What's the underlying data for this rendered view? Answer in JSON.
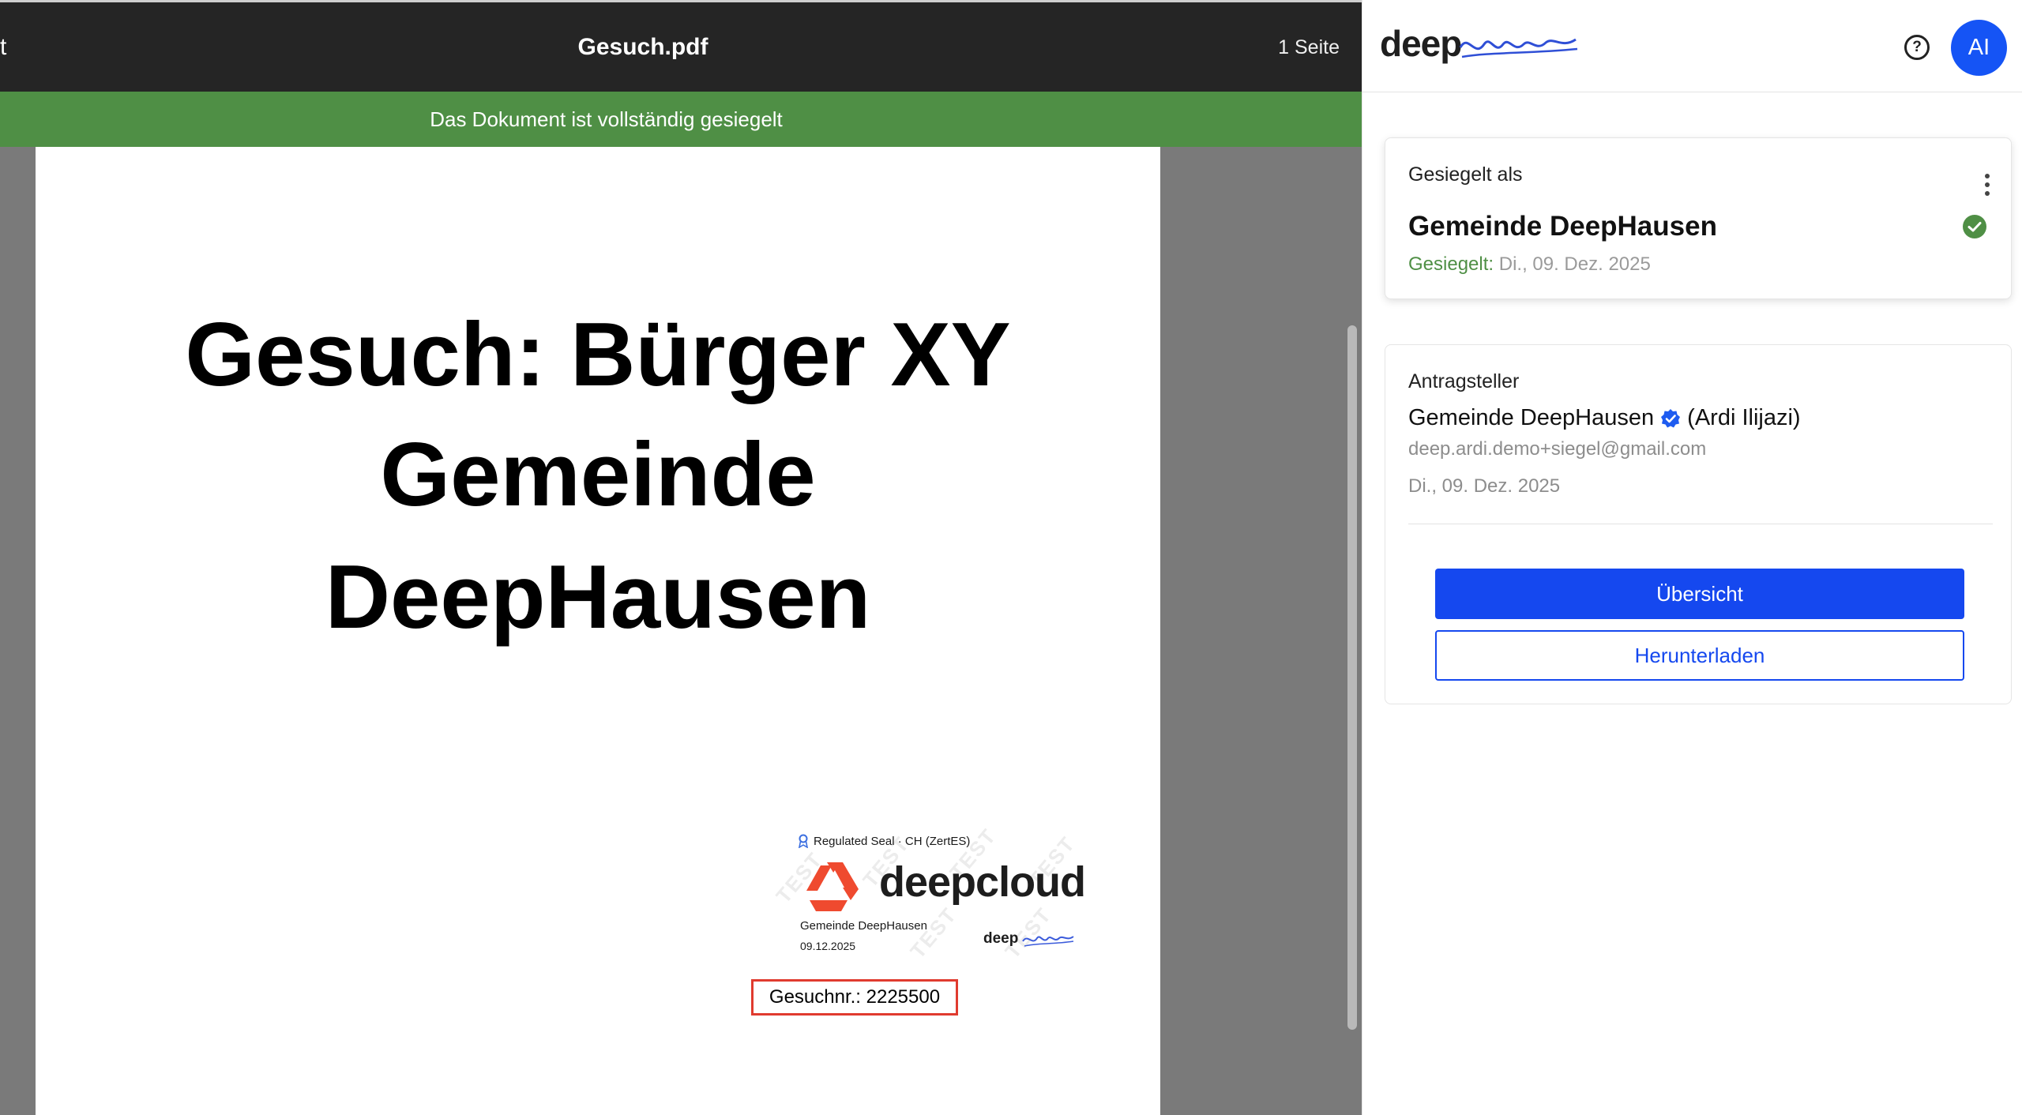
{
  "viewer": {
    "back_glyph": "t",
    "filename": "Gesuch.pdf",
    "page_count": "1 Seite",
    "banner": "Das Dokument ist vollständig gesiegelt"
  },
  "document": {
    "title_lines": [
      "Gesuch: Bürger XY",
      "Gemeinde",
      "DeepHausen"
    ],
    "seal": {
      "regulated": "Regulated Seal · CH (ZertES)",
      "brand": "deepcloud",
      "org": "Gemeinde DeepHausen",
      "date": "09.12.2025",
      "mini_brand": "deep",
      "watermark": "TEST"
    },
    "reference": "Gesuchnr.: 2225500"
  },
  "panel": {
    "logo_text": "deep",
    "help_icon": "question-circle-icon",
    "avatar_initials": "AI",
    "avatar_color": "#1554f5",
    "sealed_card": {
      "label": "Gesiegelt als",
      "name": "Gemeinde DeepHausen",
      "status_label": "Gesiegelt:",
      "status_date": "Di., 09. Dez. 2025",
      "status_color": "#4f8f45"
    },
    "applicant_card": {
      "heading": "Antragsteller",
      "name": "Gemeinde DeepHausen",
      "person": "(Ardi Ilijazi)",
      "email": "deep.ardi.demo+siegel@gmail.com",
      "date": "Di., 09. Dez. 2025",
      "overview_label": "Übersicht",
      "download_label": "Herunterladen",
      "accent_color": "#1548ef"
    }
  }
}
